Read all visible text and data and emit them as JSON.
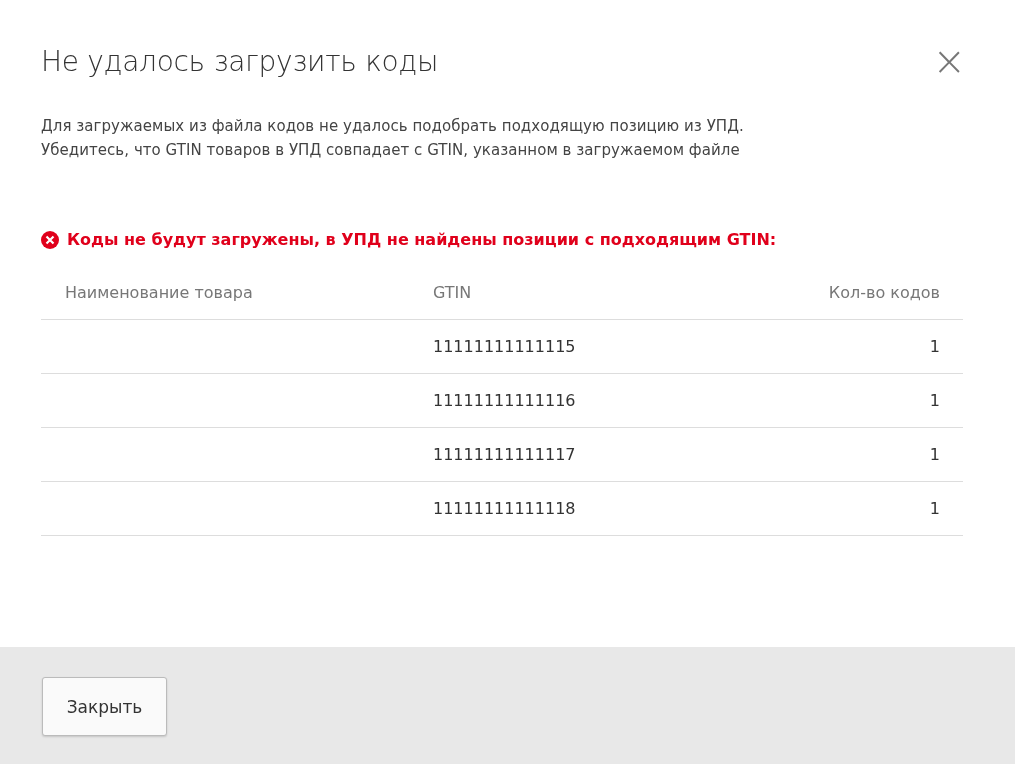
{
  "dialog": {
    "title": "Не удалось загрузить коды",
    "close": "×",
    "message": [
      "Для загружаемых из файла кодов не удалось подобрать подходящую позицию из УПД.",
      "Убедитесь, что GTIN товаров в УПД совпадает с GTIN, указанном в загружаемом файле"
    ],
    "error": "Коды не будут загружены, в УПД не найдены позиции с подходящим GTIN:",
    "table": {
      "columns": [
        "Наименование товара",
        "GTIN",
        "Кол-во кодов"
      ],
      "rows": [
        {
          "gtin": "11111111111115",
          "count": "1"
        },
        {
          "gtin": "11111111111116",
          "count": "1"
        },
        {
          "gtin": "11111111111117",
          "count": "1"
        },
        {
          "gtin": "11111111111118",
          "count": "1"
        }
      ]
    },
    "buttons": [
      "Закрыть"
    ]
  }
}
